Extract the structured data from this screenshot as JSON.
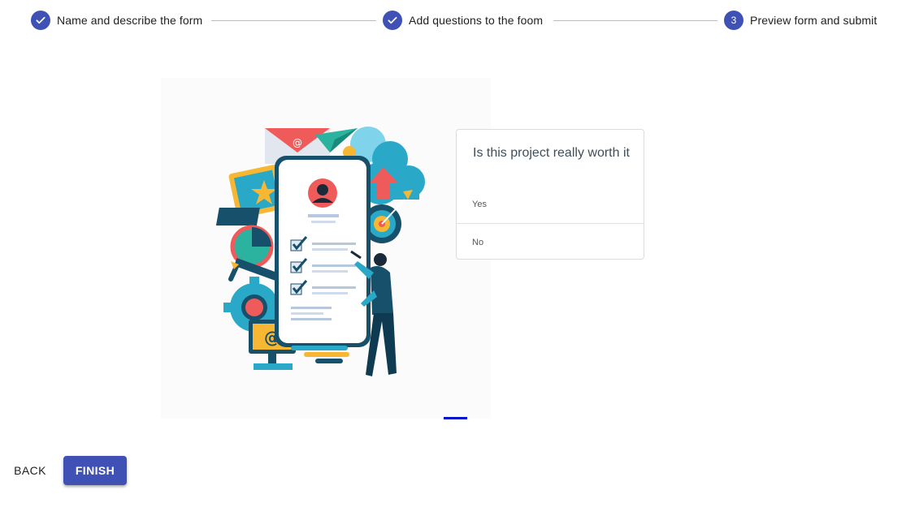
{
  "stepper": {
    "steps": [
      {
        "label": "Name and describe the form",
        "state": "completed",
        "icon": "check-icon"
      },
      {
        "label": "Add questions to the foom",
        "state": "completed",
        "icon": "check-icon"
      },
      {
        "label": "Preview form and submit",
        "state": "active",
        "number": "3"
      }
    ]
  },
  "question": {
    "title": "Is this project really worth it",
    "options": [
      "Yes",
      "No"
    ]
  },
  "actions": {
    "back_label": "BACK",
    "finish_label": "FINISH"
  },
  "illustration": {
    "icon": "form-checklist-illustration",
    "badge_text": "@",
    "monitor_text": "@"
  },
  "colors": {
    "primary": "#3f51b5",
    "indicator": "#0011cc",
    "teal": "#2aa8c7",
    "coral": "#ef5b5b",
    "orange": "#f7b733",
    "navy": "#17506b"
  }
}
